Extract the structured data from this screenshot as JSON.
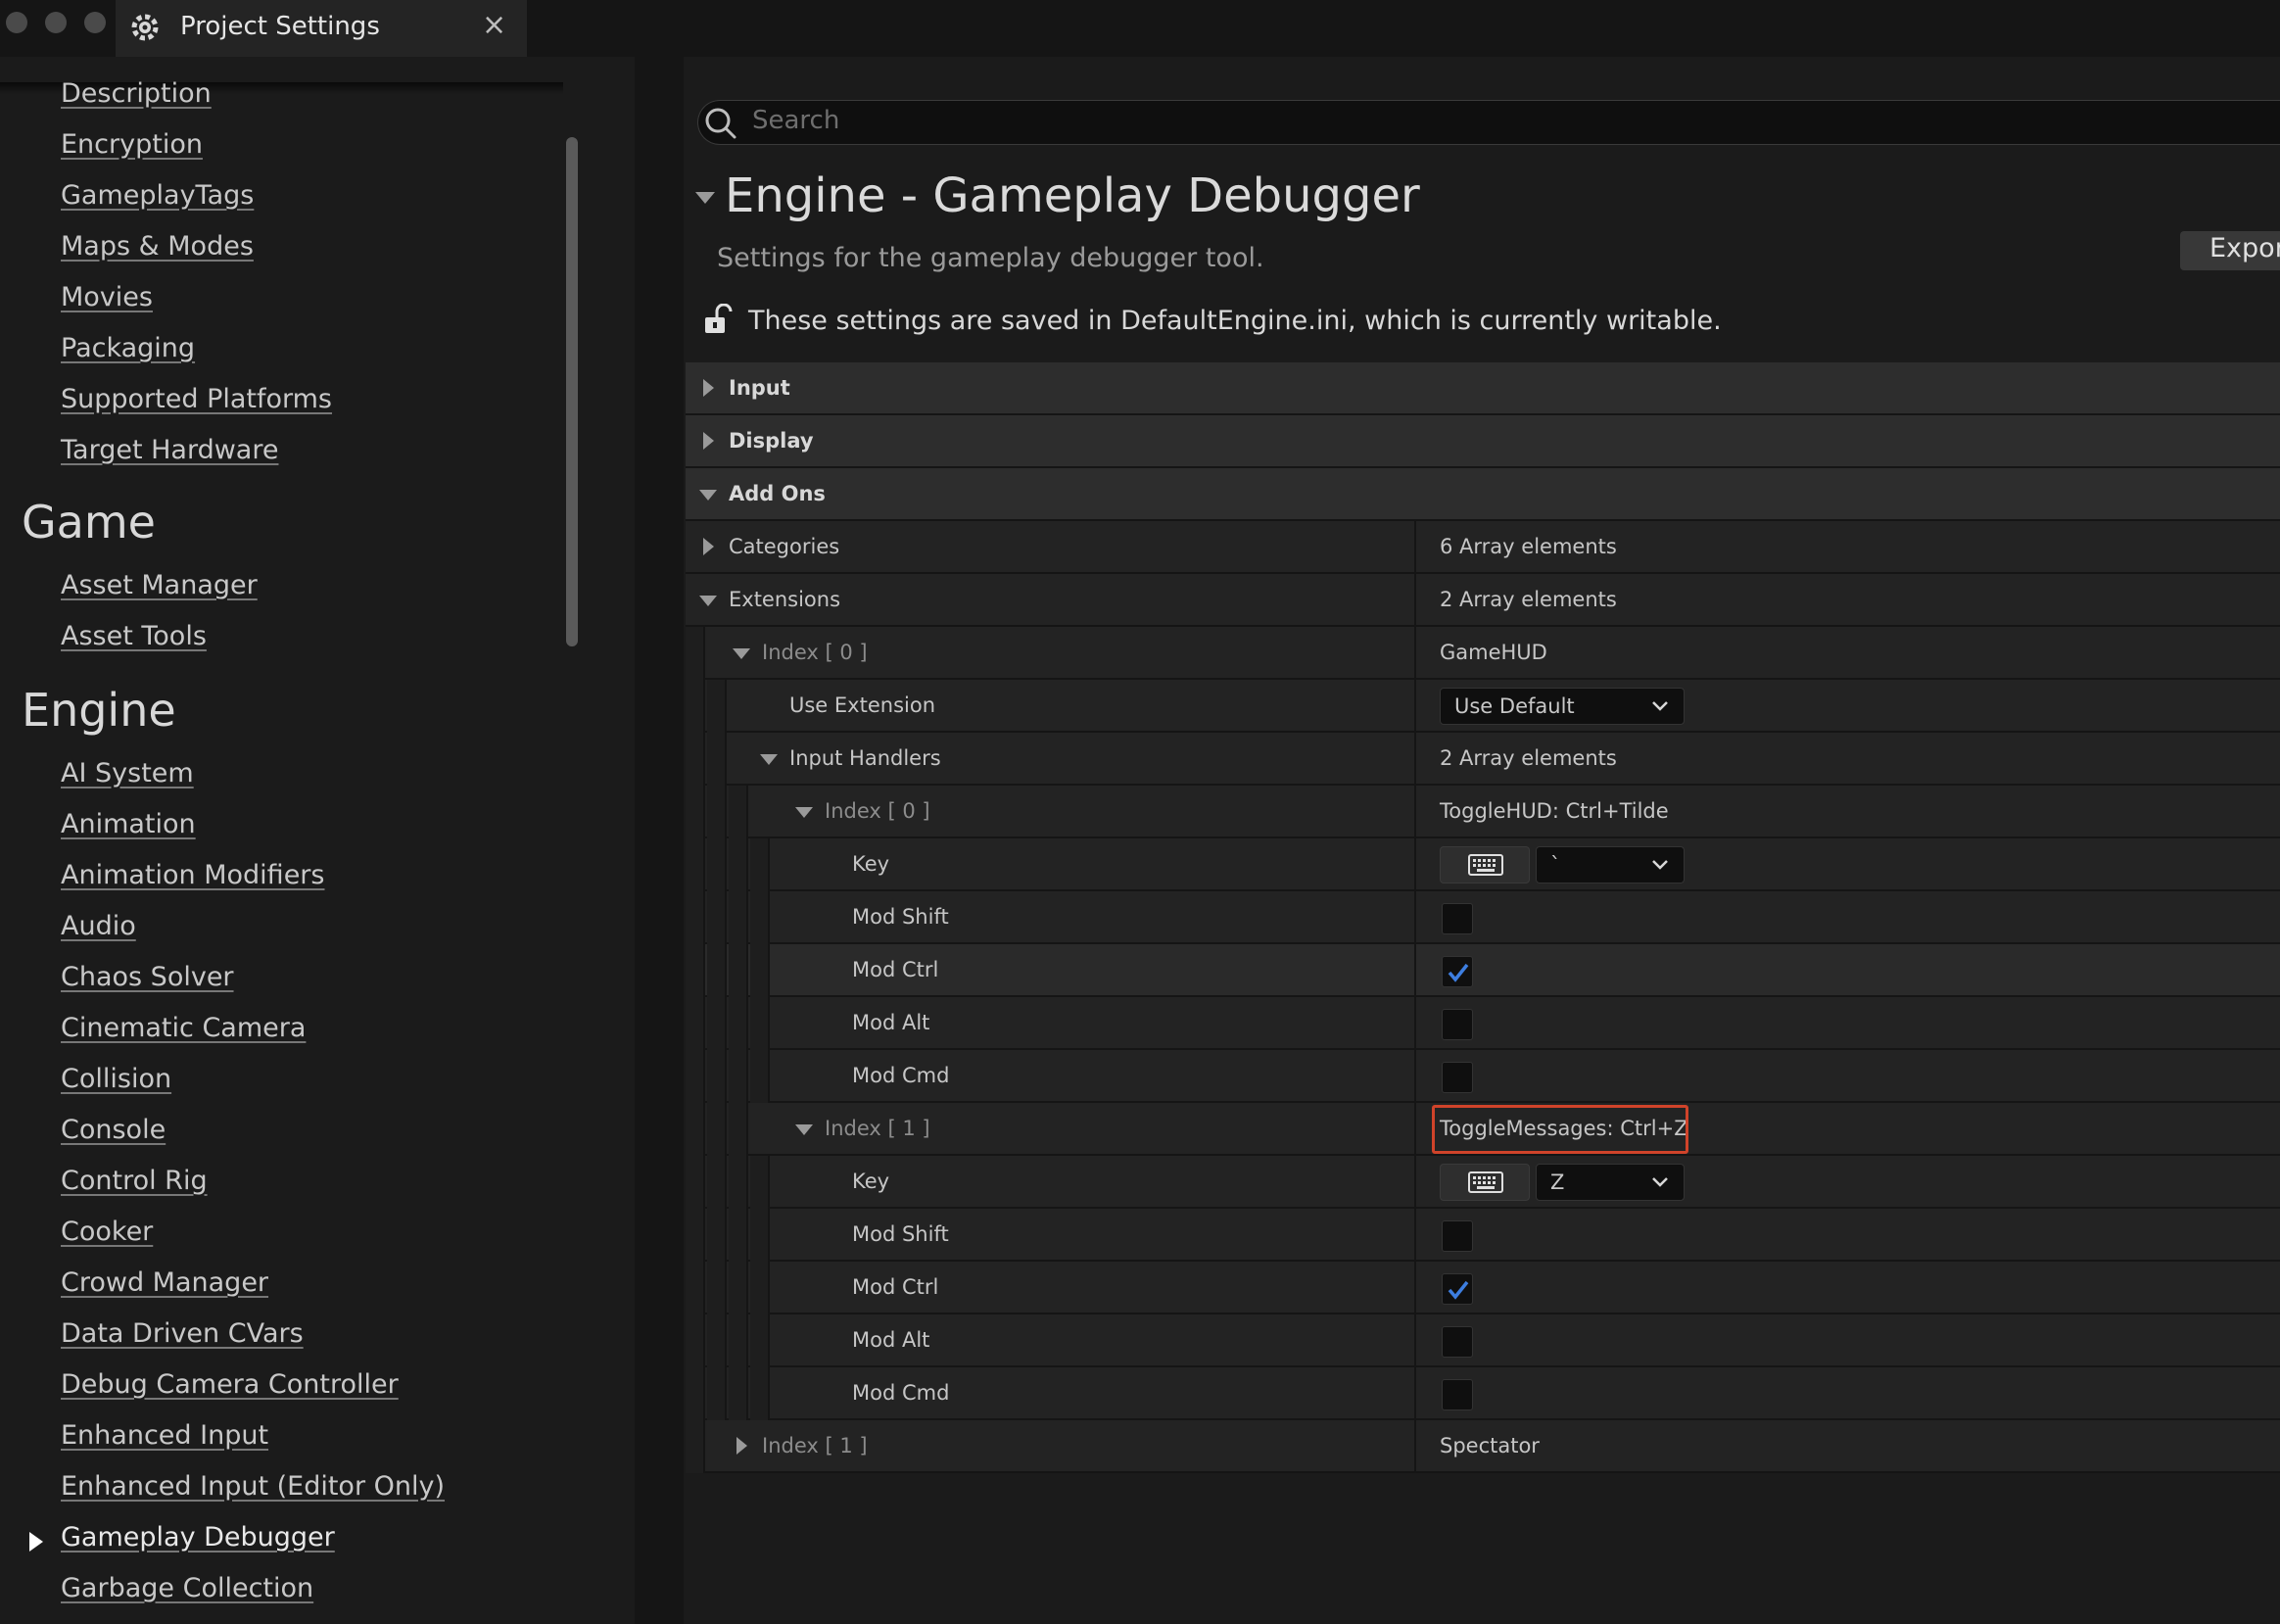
{
  "window": {
    "tab_title": "Project Settings",
    "close_label": "×"
  },
  "sidebar": {
    "top_items": [
      "Description",
      "Encryption",
      "GameplayTags",
      "Maps & Modes",
      "Movies",
      "Packaging",
      "Supported Platforms",
      "Target Hardware"
    ],
    "game_section": "Game",
    "game_items": [
      "Asset Manager",
      "Asset Tools"
    ],
    "engine_section": "Engine",
    "engine_items": [
      "AI System",
      "Animation",
      "Animation Modifiers",
      "Audio",
      "Chaos Solver",
      "Cinematic Camera",
      "Collision",
      "Console",
      "Control Rig",
      "Cooker",
      "Crowd Manager",
      "Data Driven CVars",
      "Debug Camera Controller",
      "Enhanced Input",
      "Enhanced Input (Editor Only)",
      "Gameplay Debugger",
      "Garbage Collection"
    ],
    "active_item": "Gameplay Debugger"
  },
  "search": {
    "placeholder": "Search"
  },
  "header": {
    "title": "Engine - Gameplay Debugger",
    "subtitle": "Settings for the gameplay debugger tool.",
    "export_label": "Export",
    "config_note": "These settings are saved in DefaultEngine.ini, which is currently writable."
  },
  "rows": {
    "input": "Input",
    "display": "Display",
    "addons": "Add Ons",
    "categories": {
      "name": "Categories",
      "value": "6 Array elements"
    },
    "extensions": {
      "name": "Extensions",
      "value": "2 Array elements"
    },
    "ext_index0": {
      "name": "Index [ 0 ]",
      "value": "GameHUD"
    },
    "use_extension": {
      "name": "Use Extension",
      "value": "Use Default"
    },
    "input_handlers": {
      "name": "Input Handlers",
      "value": "2 Array elements"
    },
    "ih_index0": {
      "name": "Index [ 0 ]",
      "value": "ToggleHUD: Ctrl+Tilde"
    },
    "ih0_key": {
      "name": "Key",
      "value": "`"
    },
    "ih0_mod_shift": {
      "name": "Mod Shift",
      "checked": false
    },
    "ih0_mod_ctrl": {
      "name": "Mod Ctrl",
      "checked": true
    },
    "ih0_mod_alt": {
      "name": "Mod Alt",
      "checked": false
    },
    "ih0_mod_cmd": {
      "name": "Mod Cmd",
      "checked": false
    },
    "ih_index1": {
      "name": "Index [ 1 ]",
      "value": "ToggleMessages: Ctrl+Z"
    },
    "ih1_key": {
      "name": "Key",
      "value": "Z"
    },
    "ih1_mod_shift": {
      "name": "Mod Shift",
      "checked": false
    },
    "ih1_mod_ctrl": {
      "name": "Mod Ctrl",
      "checked": true
    },
    "ih1_mod_alt": {
      "name": "Mod Alt",
      "checked": false
    },
    "ih1_mod_cmd": {
      "name": "Mod Cmd",
      "checked": false
    },
    "ext_index1": {
      "name": "Index [ 1 ]",
      "value": "Spectator"
    }
  },
  "colors": {
    "accent": "#3d7ee0",
    "highlight_border": "#d0432a"
  }
}
